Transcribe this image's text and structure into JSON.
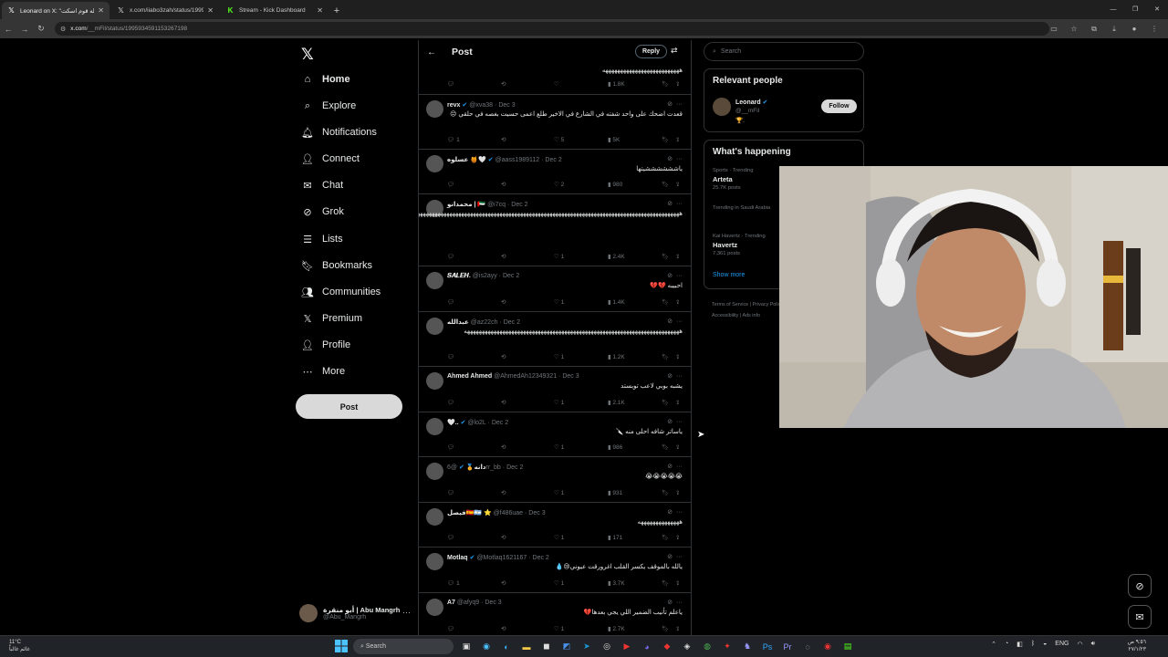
{
  "browser": {
    "tabs": [
      {
        "title": "Leonard on X: \"اتوله قوم اسكت\"",
        "icon": "x-icon",
        "active": true
      },
      {
        "title": "x.com/iiabo3zah/status/19997f",
        "icon": "x-icon",
        "active": false
      },
      {
        "title": "Stream - Kick Dashboard",
        "icon": "kick-icon",
        "active": false
      }
    ],
    "url_host": "x.com",
    "url_path": "/__mFil/status/1995934591153267198"
  },
  "nav": {
    "logo": "𝕏",
    "items": [
      {
        "label": "Home",
        "icon": "home-icon",
        "glyph": "⌂"
      },
      {
        "label": "Explore",
        "icon": "search-icon",
        "glyph": "⌕"
      },
      {
        "label": "Notifications",
        "icon": "bell-icon",
        "glyph": "🔔︎"
      },
      {
        "label": "Connect",
        "icon": "person-add-icon",
        "glyph": "👤︎"
      },
      {
        "label": "Chat",
        "icon": "mail-icon",
        "glyph": "✉"
      },
      {
        "label": "Grok",
        "icon": "grok-icon",
        "glyph": "⊘"
      },
      {
        "label": "Lists",
        "icon": "list-icon",
        "glyph": "☰"
      },
      {
        "label": "Bookmarks",
        "icon": "bookmark-icon",
        "glyph": "🔖︎"
      },
      {
        "label": "Communities",
        "icon": "people-icon",
        "glyph": "👥︎"
      },
      {
        "label": "Premium",
        "icon": "x-icon",
        "glyph": "𝕏"
      },
      {
        "label": "Profile",
        "icon": "user-icon",
        "glyph": "👤︎"
      },
      {
        "label": "More",
        "icon": "more-circle-icon",
        "glyph": "⋯"
      }
    ],
    "post_label": "Post",
    "account": {
      "name": "أبو منقرة | Abu Mangrh",
      "handle": "@Abu_Mangrh"
    }
  },
  "main": {
    "title": "Post",
    "reply_label": "Reply",
    "top_remnant_text": "ههههههههههههههههههههههههههه",
    "top_remnant_views": "1.8K",
    "tweets": [
      {
        "name": "revx",
        "verified": true,
        "handle": "@xva38",
        "date": "Dec 3",
        "text": "قعدت اضحك على واحد شفته في الشارع في الاخير طلع اعمى حسيت بغصه في حلقي 😔",
        "replies": "1",
        "retweets": "",
        "likes": "5",
        "views": "5K"
      },
      {
        "name": "عسلوه 🍯🤍",
        "verified": true,
        "handle": "@aass1989112",
        "date": "Dec 2",
        "text": "ياششششششيتها",
        "replies": "",
        "retweets": "",
        "likes": "2",
        "views": "980"
      },
      {
        "name": "محمدانو | 🇦🇪",
        "verified": false,
        "handle": "@i7cq",
        "date": "Dec 2",
        "text": "ههههههههههههههههههههههههههههههههههههههههههههههههههههههههههههههههههههههههههههههههههههههههههههههههههههههههههههههههههههههههههههههههه",
        "replies": "",
        "retweets": "",
        "likes": "1",
        "views": "2.4K"
      },
      {
        "name": "𝑺𝑨𝑳𝑬𝑯.",
        "verified": false,
        "handle": "@is2ayy",
        "date": "Dec 2",
        "text": "احبيبه 💔💔",
        "replies": "",
        "retweets": "",
        "likes": "1",
        "views": "1.4K"
      },
      {
        "name": "عبدالله",
        "verified": false,
        "handle": "@az22ch",
        "date": "Dec 2",
        "text": "هههههههههههههههههههههههههههههههههههههههههههههههههههههههههههههههههههههههههه",
        "replies": "",
        "retweets": "",
        "likes": "1",
        "views": "1.2K"
      },
      {
        "name": "Ahmed Ahmed",
        "verified": false,
        "handle": "@AhmedAh12349321",
        "date": "Dec 3",
        "text": "يشبه بوبي لاعب توبستد",
        "replies": "",
        "retweets": "",
        "likes": "1",
        "views": "2.1K"
      },
      {
        "name": "🤍..",
        "verified": true,
        "handle": "@lo2L",
        "date": "Dec 2",
        "text": "ياساتر شافه احلى منه 🔪",
        "replies": "",
        "retweets": "",
        "likes": "1",
        "views": "986"
      },
      {
        "name": "دانه🏅",
        "verified": true,
        "handle": "@6rr_bb",
        "date": "Dec 2",
        "text": "😭😭😭😭😭",
        "replies": "",
        "retweets": "",
        "likes": "1",
        "views": "931"
      },
      {
        "name": "فيصل🇪🇸🇦🇷 ⭐",
        "verified": false,
        "handle": "@f486uae",
        "date": "Dec 3",
        "text": "ههههههههههههههه",
        "replies": "",
        "retweets": "",
        "likes": "1",
        "views": "171"
      },
      {
        "name": "Motlaq",
        "verified": true,
        "handle": "@Motlaq1621167",
        "date": "Dec 2",
        "text": "يالله بالموقف يكسر القلب اغرورقت عيوني😢💧",
        "replies": "1",
        "retweets": "",
        "likes": "1",
        "views": "3.7K"
      },
      {
        "name": "A7",
        "verified": false,
        "handle": "@afyq9",
        "date": "Dec 3",
        "text": "ياعلم تأنيب الضمير اللي يجي بعدها💔",
        "replies": "",
        "retweets": "",
        "likes": "1",
        "views": "2.7K"
      }
    ]
  },
  "right": {
    "search_placeholder": "Search",
    "relevant_title": "Relevant people",
    "relevant_person": {
      "name": "Leonard",
      "handle": "@__mFil",
      "bio": "🏆.",
      "follow_label": "Follow"
    },
    "happening_title": "What's happening",
    "trends": [
      {
        "meta": "Sports · Trending",
        "name": "Arteta",
        "posts": "25.7K posts"
      },
      {
        "meta": "Trending in Saudi Arabia",
        "name": "",
        "posts": ""
      },
      {
        "meta": "Kai Havertz · Trending",
        "name": "Havertz",
        "posts": "7,361 posts"
      }
    ],
    "show_more": "Show more",
    "footer": [
      "Terms of Service",
      "Privacy Policy",
      "Accessibility",
      "Ads info"
    ]
  },
  "taskbar": {
    "weather_temp": "11°C",
    "weather_desc": "غائم غالباً",
    "search_label": "Search",
    "lang": "ENG",
    "time": "٩:٥٦ ص",
    "date": "٢٧/١/٢٣"
  },
  "colors": {
    "accent": "#1d9bf0",
    "border": "#2f3336",
    "muted": "#71767b"
  }
}
